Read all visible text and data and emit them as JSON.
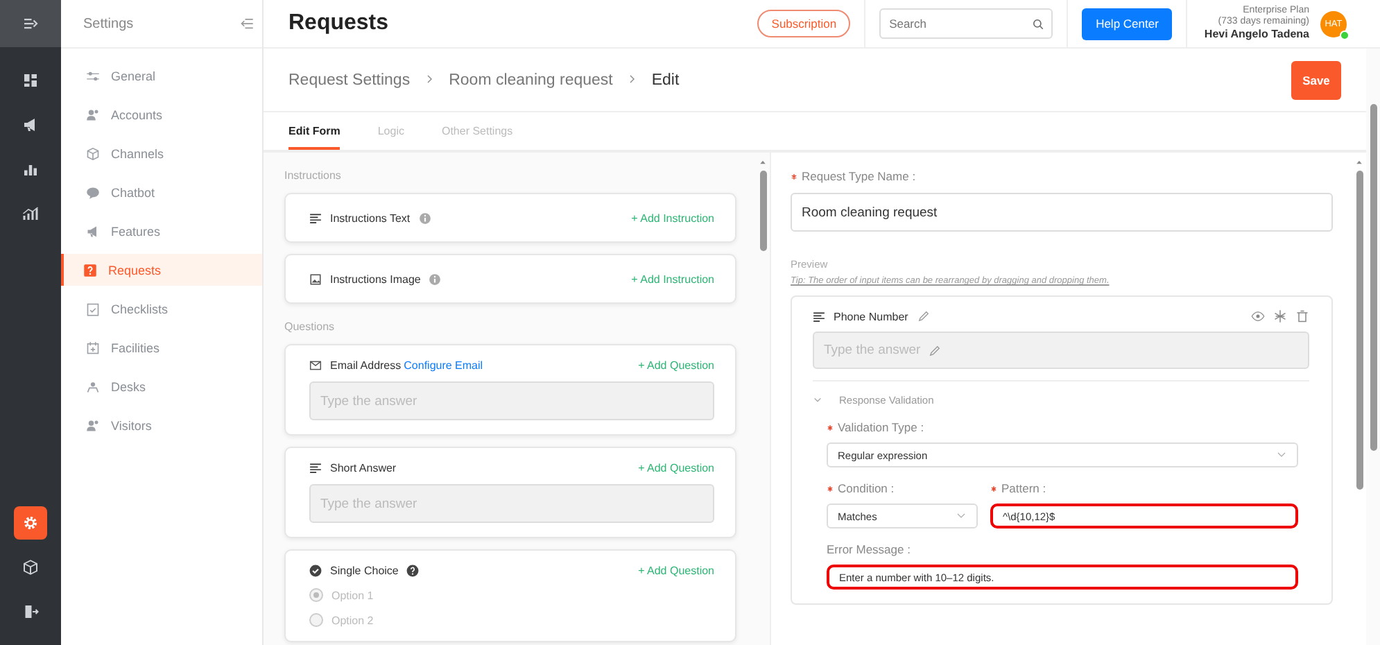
{
  "rail": {
    "top": [
      {
        "kind": "expand",
        "selected": false
      },
      {
        "kind": "dashboard",
        "selected": false
      },
      {
        "kind": "megaphone",
        "selected": false
      },
      {
        "kind": "ranking",
        "selected": false
      },
      {
        "kind": "chart",
        "selected": false
      }
    ],
    "bottom": [
      {
        "kind": "settings",
        "selected": true
      },
      {
        "kind": "box",
        "selected": false
      },
      {
        "kind": "logout",
        "selected": false
      }
    ]
  },
  "settings_nav": {
    "title": "Settings",
    "items": [
      {
        "label": "General",
        "kind": "sliders",
        "selected": false
      },
      {
        "label": "Accounts",
        "kind": "people",
        "selected": false
      },
      {
        "label": "Channels",
        "kind": "box",
        "selected": false
      },
      {
        "label": "Chatbot",
        "kind": "bubble",
        "selected": false
      },
      {
        "label": "Features",
        "kind": "megaphone",
        "selected": false
      },
      {
        "label": "Requests",
        "kind": "question",
        "selected": true
      },
      {
        "label": "Checklists",
        "kind": "checklist",
        "selected": false
      },
      {
        "label": "Facilities",
        "kind": "calendar",
        "selected": false
      },
      {
        "label": "Desks",
        "kind": "desk",
        "selected": false
      },
      {
        "label": "Visitors",
        "kind": "people",
        "selected": false
      }
    ]
  },
  "header": {
    "title": "Requests",
    "subscription": "Subscription",
    "search": {
      "placeholder": "Search"
    },
    "help": "Help Center",
    "plan": "Enterprise Plan",
    "remaining": "(733 days remaining)",
    "user": "Hevi Angelo Tadena",
    "avatar": "HAT",
    "online": true
  },
  "breadcrumb": [
    "Request Settings",
    "Room cleaning request",
    "Edit"
  ],
  "save": "Save",
  "tabs": [
    {
      "label": "Edit Form",
      "selected": true
    },
    {
      "label": "Logic",
      "selected": false
    },
    {
      "label": "Other Settings",
      "selected": false
    }
  ],
  "instructions": {
    "heading": "Instructions",
    "items": [
      {
        "kind": "text",
        "label": "Instructions Text",
        "action": "+ Add Instruction"
      },
      {
        "kind": "image",
        "label": "Instructions Image",
        "action": "+ Add Instruction"
      }
    ]
  },
  "questions": {
    "heading": "Questions",
    "items": [
      {
        "kind": "email",
        "label": "Email Address",
        "link": "Configure Email",
        "action": "+ Add Question",
        "placeholder": "Type the answer"
      },
      {
        "kind": "short",
        "label": "Short Answer",
        "action": "+ Add Question",
        "placeholder": "Type the answer"
      },
      {
        "kind": "choice",
        "label": "Single Choice",
        "action": "+ Add Question",
        "options": [
          {
            "label": "Option 1",
            "selected": true
          },
          {
            "label": "Option 2",
            "selected": false
          }
        ]
      }
    ]
  },
  "form": {
    "name_required": true,
    "name_label": "Request Type Name :",
    "name_value": "Room cleaning request",
    "preview": "Preview",
    "tip": "Tip: The order of input items can be rearranged by dragging and dropping them.",
    "field": {
      "label": "Phone Number",
      "placeholder": "Type the answer",
      "validation": {
        "title": "Response Validation",
        "expanded": true,
        "type_required": true,
        "type_label": "Validation Type :",
        "type_value": "Regular expression",
        "condition_required": true,
        "condition_label": "Condition :",
        "condition_value": "Matches",
        "pattern_required": true,
        "pattern_label": "Pattern :",
        "pattern_value": "^\\d{10,12}$",
        "pattern_highlighted": true,
        "error_label": "Error Message :",
        "error_value": "Enter a number with 10–12 digits.",
        "error_highlighted": true
      }
    }
  }
}
